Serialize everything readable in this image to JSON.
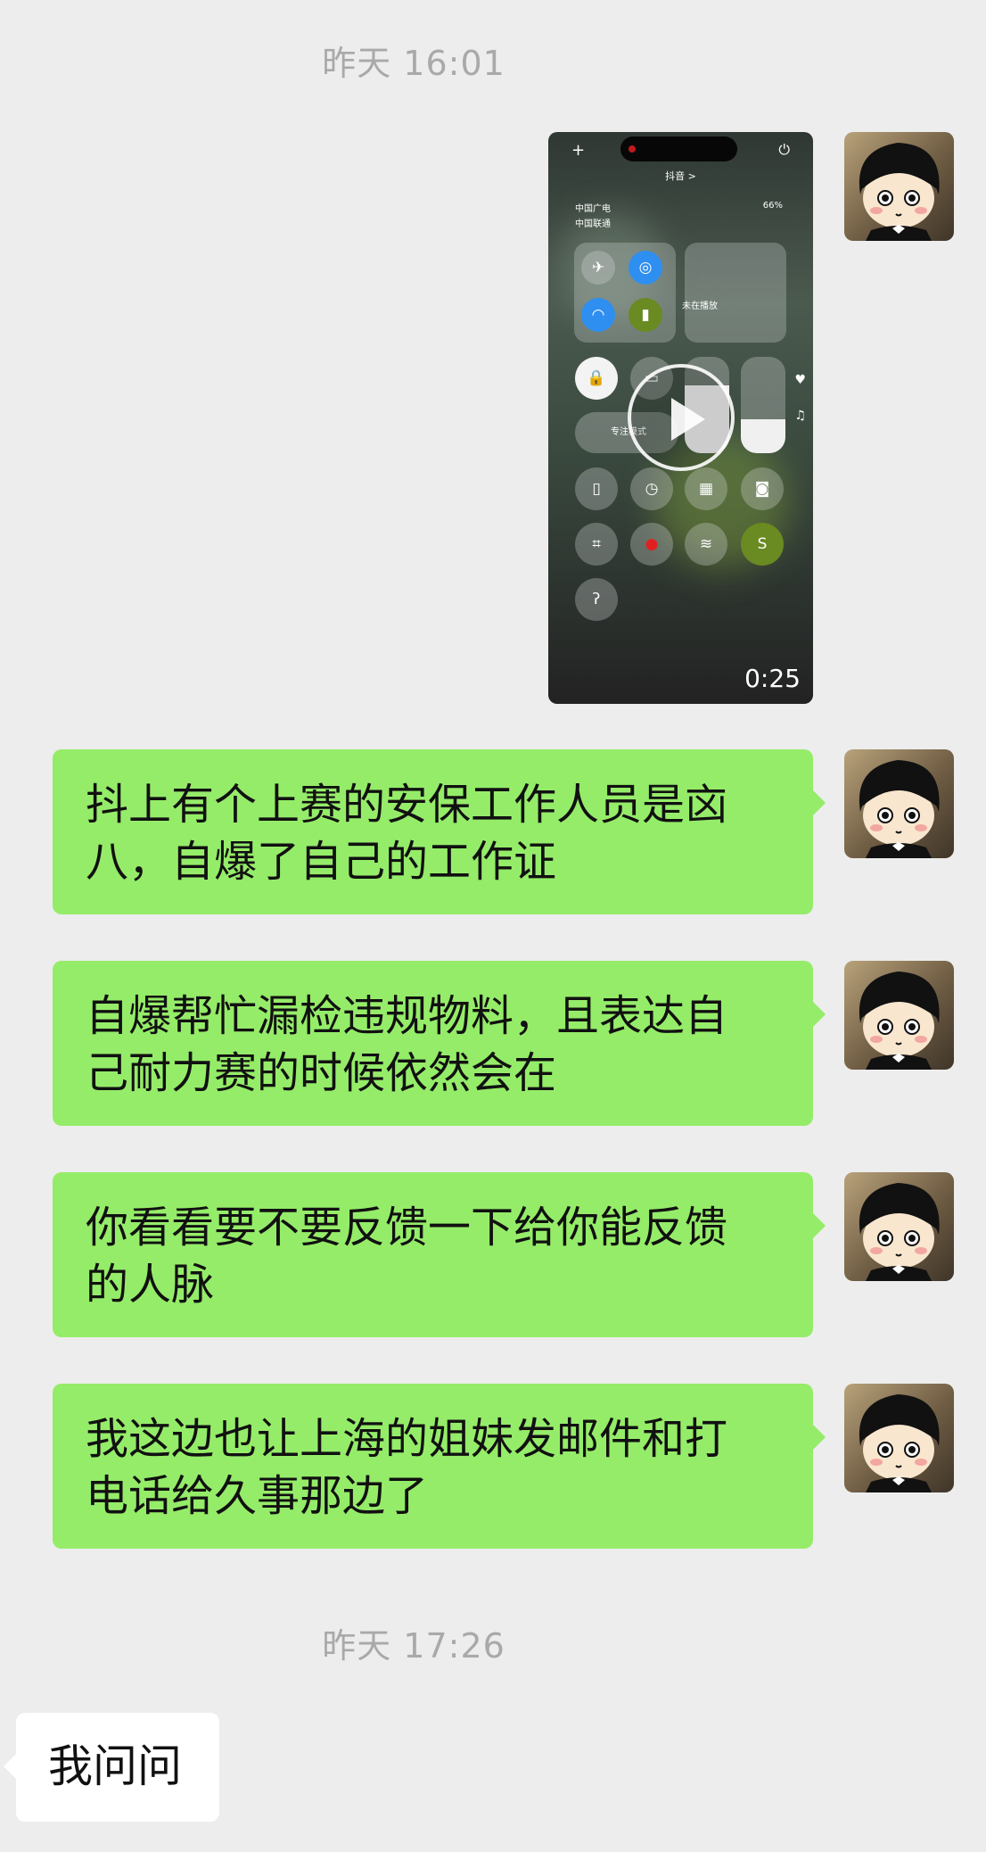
{
  "timestamps": [
    "昨天 16:01",
    "昨天 17:26"
  ],
  "video_message": {
    "duration": "0:25",
    "app_name": "抖音 >",
    "carrier_1": "中国广电",
    "carrier_2": "中国联通",
    "battery": "66%",
    "now_playing": "未在播放",
    "focus_mode": "专注模式"
  },
  "sent_messages": [
    {
      "line1": "抖上有个上赛的安保工作人员是㐫",
      "line2": "八，自爆了自己的工作证"
    },
    {
      "line1": "自爆帮忙漏检违规物料，且表达自",
      "line2": "己耐力赛的时候依然会在"
    },
    {
      "line1": "你看看要不要反馈一下给你能反馈",
      "line2": "的人脉"
    },
    {
      "line1": "我这边也让上海的姐妹发邮件和打",
      "line2": "电话给久事那边了"
    }
  ],
  "received_messages": [
    {
      "text": "我问问"
    }
  ],
  "colors": {
    "background": "#ededed",
    "sent_bubble": "#95ec69",
    "received_bubble": "#ffffff",
    "timestamp": "#a9a9a9"
  }
}
